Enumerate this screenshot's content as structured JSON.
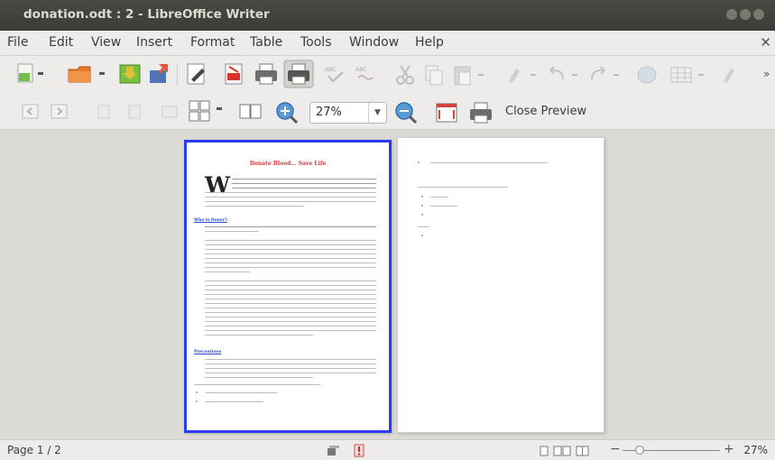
{
  "window": {
    "title": "donation.odt : 2 - LibreOffice Writer"
  },
  "menu": {
    "file": "File",
    "edit": "Edit",
    "view": "View",
    "insert": "Insert",
    "format": "Format",
    "table": "Table",
    "tools": "Tools",
    "window": "Window",
    "help": "Help"
  },
  "preview_toolbar": {
    "zoom_value": "27%",
    "close_preview_label": "Close Preview"
  },
  "document": {
    "title": "Donate Blood... Save Life",
    "dropcap": "W",
    "section1": "Who is Donor?",
    "section2": "Precautions"
  },
  "statusbar": {
    "page_label": "Page 1 / 2",
    "zoom_percent": "27%"
  },
  "colors": {
    "titlebar": "#3c3b37",
    "page_selected_border": "#2b3cf0",
    "doc_title": "#e0343c",
    "section_heading": "#2a4ad8"
  }
}
